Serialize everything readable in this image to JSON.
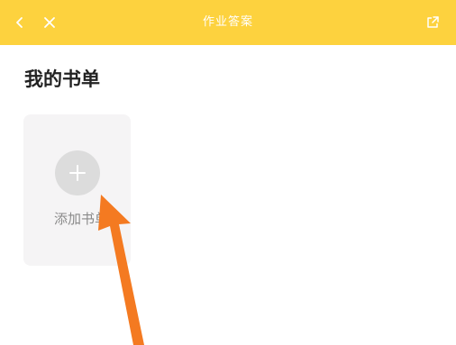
{
  "header": {
    "title": "作业答案",
    "back_icon": "chevron-left-icon",
    "close_icon": "close-icon",
    "share_icon": "share-icon",
    "background_color": "#FDD23E"
  },
  "main": {
    "section_title": "我的书单",
    "add_book": {
      "label": "添加书单",
      "icon": "plus-icon"
    }
  },
  "annotation": {
    "icon": "pointer-arrow-icon",
    "color": "#F47A21"
  }
}
